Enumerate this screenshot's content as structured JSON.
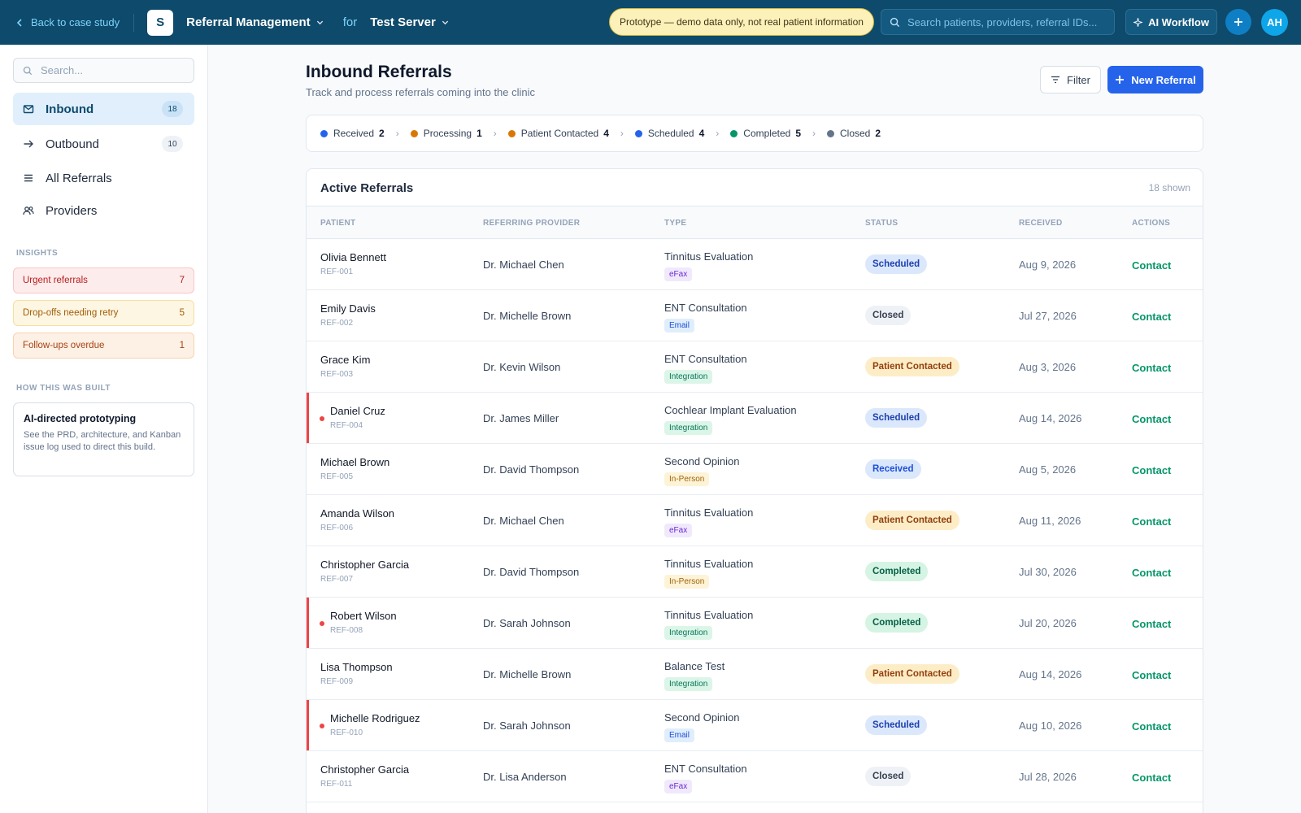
{
  "topbar": {
    "back_label": "Back to case study",
    "logo_letter": "S",
    "app_name": "Referral Management",
    "for_label": "for",
    "server_name": "Test Server",
    "prototype_notice": "Prototype — demo data only, not real patient information",
    "search_placeholder": "Search patients, providers, referral IDs...",
    "ai_workflow_label": "AI Workflow",
    "avatar_initials": "AH"
  },
  "sidebar": {
    "search_placeholder": "Search...",
    "nav": [
      {
        "label": "Inbound",
        "count": "18",
        "icon": "inbox-icon",
        "active": true
      },
      {
        "label": "Outbound",
        "count": "10",
        "icon": "arrow-right-icon"
      },
      {
        "label": "All Referrals",
        "icon": "list-icon"
      },
      {
        "label": "Providers",
        "icon": "users-icon"
      }
    ],
    "insights_heading": "INSIGHTS",
    "insights": [
      {
        "label": "Urgent referrals",
        "count": "7"
      },
      {
        "label": "Drop-offs needing retry",
        "count": "5"
      },
      {
        "label": "Follow-ups overdue",
        "count": "1"
      }
    ],
    "built_heading": "HOW THIS WAS BUILT",
    "built_title": "AI-directed prototyping",
    "built_desc": "See the PRD, architecture, and Kanban issue log used to direct this build."
  },
  "main": {
    "title": "Inbound Referrals",
    "subtitle": "Track and process referrals coming into the clinic",
    "filter_label": "Filter",
    "new_label": "New Referral"
  },
  "pipeline": [
    {
      "label": "Received",
      "count": "2",
      "color": "#2563eb"
    },
    {
      "label": "Processing",
      "count": "1",
      "color": "#d97706"
    },
    {
      "label": "Patient Contacted",
      "count": "4",
      "color": "#d97706"
    },
    {
      "label": "Scheduled",
      "count": "4",
      "color": "#2563eb"
    },
    {
      "label": "Completed",
      "count": "5",
      "color": "#059669"
    },
    {
      "label": "Closed",
      "count": "2",
      "color": "#64748b"
    }
  ],
  "table": {
    "title": "Active Referrals",
    "shown": "18 shown",
    "columns": [
      "PATIENT",
      "REFERRING PROVIDER",
      "TYPE",
      "STATUS",
      "RECEIVED",
      "ACTIONS"
    ],
    "action_label": "Contact",
    "rows": [
      {
        "patient": "Olivia Bennett",
        "id": "REF-001",
        "provider": "Dr. Michael Chen",
        "type": "Tinnitus Evaluation",
        "channel": "eFax",
        "status": "Scheduled",
        "received": "Aug 9, 2026",
        "urgent": false
      },
      {
        "patient": "Emily Davis",
        "id": "REF-002",
        "provider": "Dr. Michelle Brown",
        "type": "ENT Consultation",
        "channel": "Email",
        "status": "Closed",
        "received": "Jul 27, 2026",
        "urgent": false
      },
      {
        "patient": "Grace Kim",
        "id": "REF-003",
        "provider": "Dr. Kevin Wilson",
        "type": "ENT Consultation",
        "channel": "Integration",
        "status": "Patient Contacted",
        "received": "Aug 3, 2026",
        "urgent": false
      },
      {
        "patient": "Daniel Cruz",
        "id": "REF-004",
        "provider": "Dr. James Miller",
        "type": "Cochlear Implant Evaluation",
        "channel": "Integration",
        "status": "Scheduled",
        "received": "Aug 14, 2026",
        "urgent": true
      },
      {
        "patient": "Michael Brown",
        "id": "REF-005",
        "provider": "Dr. David Thompson",
        "type": "Second Opinion",
        "channel": "In-Person",
        "status": "Received",
        "received": "Aug 5, 2026",
        "urgent": false
      },
      {
        "patient": "Amanda Wilson",
        "id": "REF-006",
        "provider": "Dr. Michael Chen",
        "type": "Tinnitus Evaluation",
        "channel": "eFax",
        "status": "Patient Contacted",
        "received": "Aug 11, 2026",
        "urgent": false
      },
      {
        "patient": "Christopher Garcia",
        "id": "REF-007",
        "provider": "Dr. David Thompson",
        "type": "Tinnitus Evaluation",
        "channel": "In-Person",
        "status": "Completed",
        "received": "Jul 30, 2026",
        "urgent": false
      },
      {
        "patient": "Robert Wilson",
        "id": "REF-008",
        "provider": "Dr. Sarah Johnson",
        "type": "Tinnitus Evaluation",
        "channel": "Integration",
        "status": "Completed",
        "received": "Jul 20, 2026",
        "urgent": true
      },
      {
        "patient": "Lisa Thompson",
        "id": "REF-009",
        "provider": "Dr. Michelle Brown",
        "type": "Balance Test",
        "channel": "Integration",
        "status": "Patient Contacted",
        "received": "Aug 14, 2026",
        "urgent": false
      },
      {
        "patient": "Michelle Rodriguez",
        "id": "REF-010",
        "provider": "Dr. Sarah Johnson",
        "type": "Second Opinion",
        "channel": "Email",
        "status": "Scheduled",
        "received": "Aug 10, 2026",
        "urgent": true
      },
      {
        "patient": "Christopher Garcia",
        "id": "REF-011",
        "provider": "Dr. Lisa Anderson",
        "type": "ENT Consultation",
        "channel": "eFax",
        "status": "Closed",
        "received": "Jul 28, 2026",
        "urgent": false
      }
    ]
  }
}
